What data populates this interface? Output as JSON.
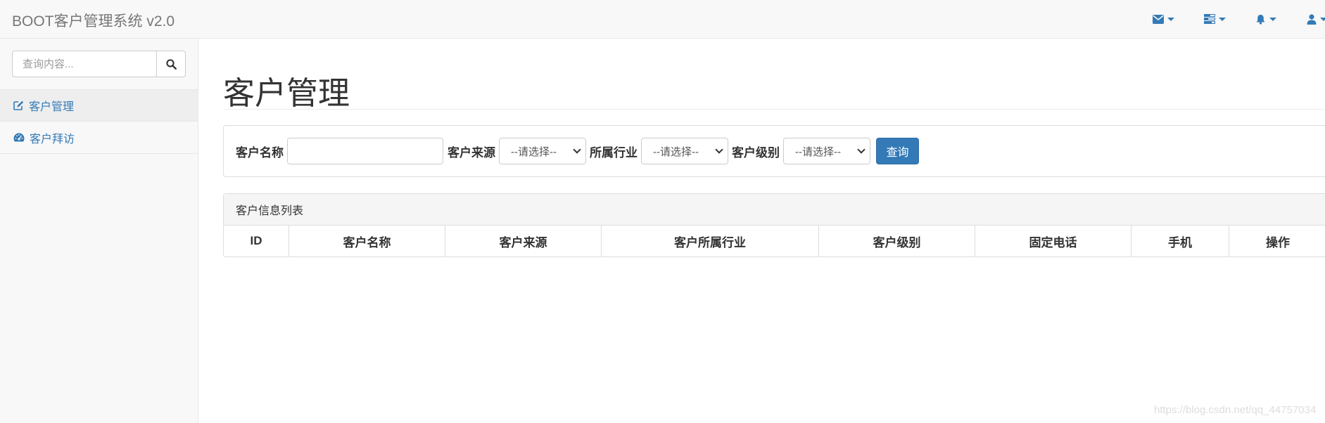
{
  "navbar": {
    "brand": "BOOT客户管理系统 v2.0",
    "icons": [
      "envelope-icon",
      "tasks-icon",
      "bell-icon",
      "user-icon"
    ],
    "accent": "#337ab7"
  },
  "sidebar": {
    "search": {
      "placeholder": "查询内容..."
    },
    "items": [
      {
        "label": "客户管理",
        "icon": "edit-icon",
        "active": true
      },
      {
        "label": "客户拜访",
        "icon": "dashboard-icon",
        "active": false
      }
    ]
  },
  "main": {
    "title": "客户管理",
    "filters": {
      "name_label": "客户名称",
      "name_value": "",
      "source_label": "客户来源",
      "source_value": "--请选择--",
      "industry_label": "所属行业",
      "industry_value": "--请选择--",
      "level_label": "客户级别",
      "level_value": "--请选择--",
      "query_button": "查询"
    },
    "list": {
      "heading": "客户信息列表",
      "columns": [
        "ID",
        "客户名称",
        "客户来源",
        "客户所属行业",
        "客户级别",
        "固定电话",
        "手机",
        "操作"
      ]
    }
  },
  "watermark": "https://blog.csdn.net/qq_44757034"
}
